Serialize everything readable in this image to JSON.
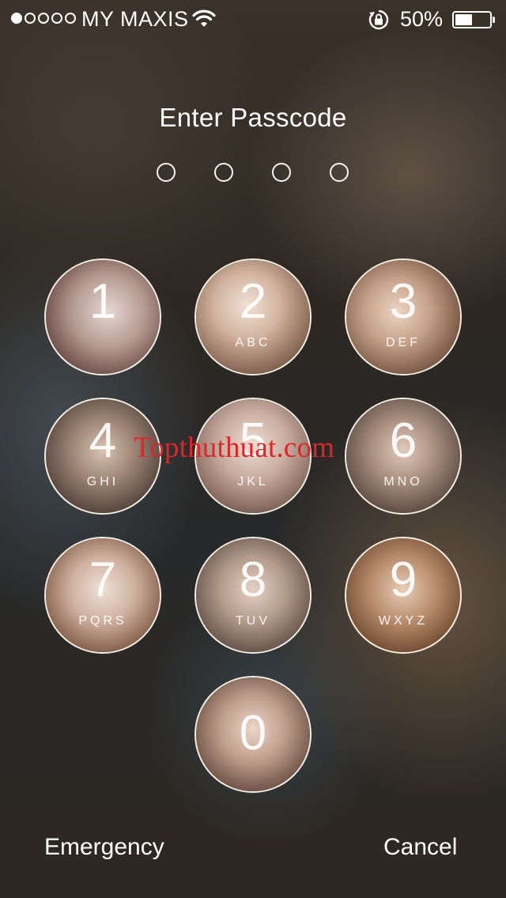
{
  "status_bar": {
    "signal_bars_filled": 1,
    "signal_bars_total": 5,
    "carrier": "MY MAXIS",
    "wifi_icon": "wifi-icon",
    "orientation_lock_icon": "orientation-lock-icon",
    "battery_text": "50%",
    "battery_level": 0.5
  },
  "passcode": {
    "title": "Enter Passcode",
    "entered_digits": 0,
    "total_digits": 4
  },
  "keypad": {
    "keys": [
      {
        "digit": "1",
        "letters": ""
      },
      {
        "digit": "2",
        "letters": "ABC"
      },
      {
        "digit": "3",
        "letters": "DEF"
      },
      {
        "digit": "4",
        "letters": "GHI"
      },
      {
        "digit": "5",
        "letters": "JKL"
      },
      {
        "digit": "6",
        "letters": "MNO"
      },
      {
        "digit": "7",
        "letters": "PQRS"
      },
      {
        "digit": "8",
        "letters": "TUV"
      },
      {
        "digit": "9",
        "letters": "WXYZ"
      },
      {
        "digit": "0",
        "letters": ""
      }
    ]
  },
  "watermark": "Topthuthuat.com",
  "buttons": {
    "emergency": "Emergency",
    "cancel": "Cancel"
  },
  "colors": {
    "watermark": "#e0242a",
    "text": "#ffffff"
  }
}
